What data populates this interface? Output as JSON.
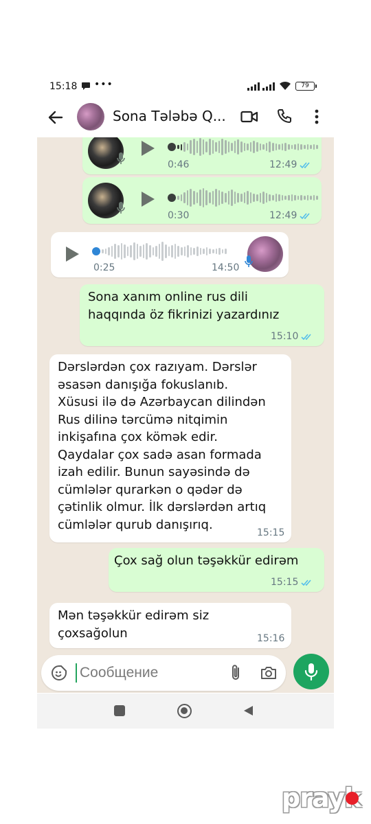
{
  "status_bar": {
    "time": "15:18",
    "dots": "•••",
    "battery": "79"
  },
  "header": {
    "contact_name": "Sona Tələbə Q..."
  },
  "messages": [
    {
      "type": "voice",
      "direction": "out",
      "duration": "0:46",
      "time": "12:49",
      "status": "read"
    },
    {
      "type": "voice",
      "direction": "out",
      "duration": "0:30",
      "time": "12:49",
      "status": "read"
    },
    {
      "type": "voice",
      "direction": "in",
      "duration": "0:25",
      "time": "14:50"
    },
    {
      "type": "text",
      "direction": "out",
      "lines": [
        "Sona xanım online rus dili",
        "haqqında öz fikrinizi yazardınız"
      ],
      "time": "15:10",
      "status": "read"
    },
    {
      "type": "text",
      "direction": "in",
      "lines": [
        "Dərslərdən çox razıyam. Dərslər",
        "əsasən danışığa fokuslanıb.",
        "Xüsusi ilə də Azərbaycan dilindən",
        "Rus dilinə tərcümə nitqimin",
        "inkişafına çox kömək edir.",
        "Qaydalar çox sadə asan formada",
        "izah edilir. Bunun sayəsində də",
        "cümlələr qurarkən o qədər də",
        "çətinlik olmur. İlk dərslərdən artıq",
        "cümlələr qurub danışırıq."
      ],
      "time": "15:15"
    },
    {
      "type": "text",
      "direction": "out",
      "lines": [
        "Çox sağ olun təşəkkür edirəm"
      ],
      "time": "15:15",
      "status": "read"
    },
    {
      "type": "text",
      "direction": "in",
      "lines": [
        "Mən təşəkkür edirəm siz",
        "çoxsağolun"
      ],
      "time": "15:16"
    }
  ],
  "input": {
    "placeholder": "Сообщение"
  },
  "brand": "prayk",
  "colors": {
    "outgoing": "#d9fdd3",
    "incoming": "#ffffff",
    "chat_bg": "#efe7dd",
    "accent": "#1da560",
    "read_ticks": "#53bdeb",
    "brand_dot": "#e8202a"
  },
  "icons": [
    "back-arrow-icon",
    "video-call-icon",
    "phone-call-icon",
    "more-menu-icon",
    "play-icon",
    "mic-icon",
    "emoji-icon",
    "attach-icon",
    "camera-icon"
  ]
}
